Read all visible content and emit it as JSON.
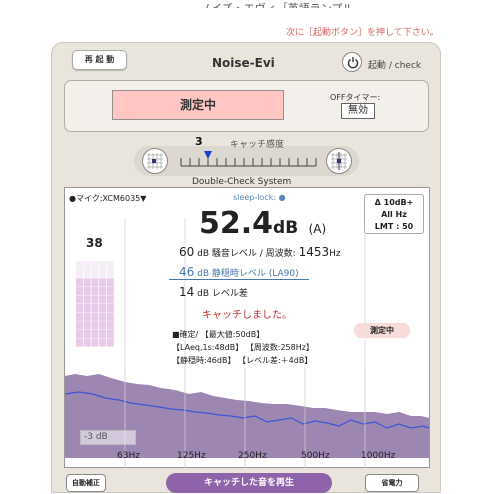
{
  "background": {
    "title_fragment": "ノイズ・エヴィ［英語ランプル版］",
    "notice": "次に［起動ボタン］を押して下さい。"
  },
  "header": {
    "restart_label": "再 起 動",
    "app_title": "Noise-Evi",
    "power_icon": "power-icon",
    "check_label": "起動 / check"
  },
  "measure": {
    "button_label": "測定中",
    "timer_label": "OFFタイマー:",
    "timer_value": "無効"
  },
  "sensitivity": {
    "value": "3",
    "label": "キャッチ感度",
    "system_label": "Double-Check System",
    "level": 3,
    "max": 15
  },
  "screen": {
    "mic_label": "●マイク:XCM6035▼",
    "sleep_label": "sleep-lock: ●",
    "info_line1": "Δ 10dB+",
    "info_line2": "All Hz",
    "info_line3": "LMT : 50",
    "level_number": "38",
    "level_fraction": 0.76,
    "big_value": "52.4",
    "big_unit": "dB",
    "big_suffix": "(A)",
    "noise_num": "60",
    "noise_label": "dB  騒音レベル / 周波数:",
    "noise_freq": "1453",
    "noise_freq_unit": "Hz",
    "quiet_num": "46",
    "quiet_label": "dB  静穏時レベル (LA90)",
    "diff_num": "14",
    "diff_label": "dB  レベル差",
    "catch_message": "キャッチしました。",
    "measuring_badge": "測定中",
    "stats_line1": "■確定/ 【最大値:50dB】",
    "stats_line2": "【LAeq,1s:48dB】 【周波数:258Hz】",
    "stats_line3": "【静穏時:46dB】 【レベル差:＋4dB】",
    "db_floor": "-3 dB",
    "freq_labels": [
      "63Hz",
      "125Hz",
      "250Hz",
      "500Hz",
      "1000Hz"
    ]
  },
  "footer": {
    "auto_label": "自動補正",
    "play_label": "キャッチした音を再生",
    "eco_label": "省電力"
  },
  "colors": {
    "accent": "#8e63a9",
    "measure_button": "#ffc6c4",
    "quiet_text": "#4a76b0",
    "catch_text": "#c42c2c"
  }
}
